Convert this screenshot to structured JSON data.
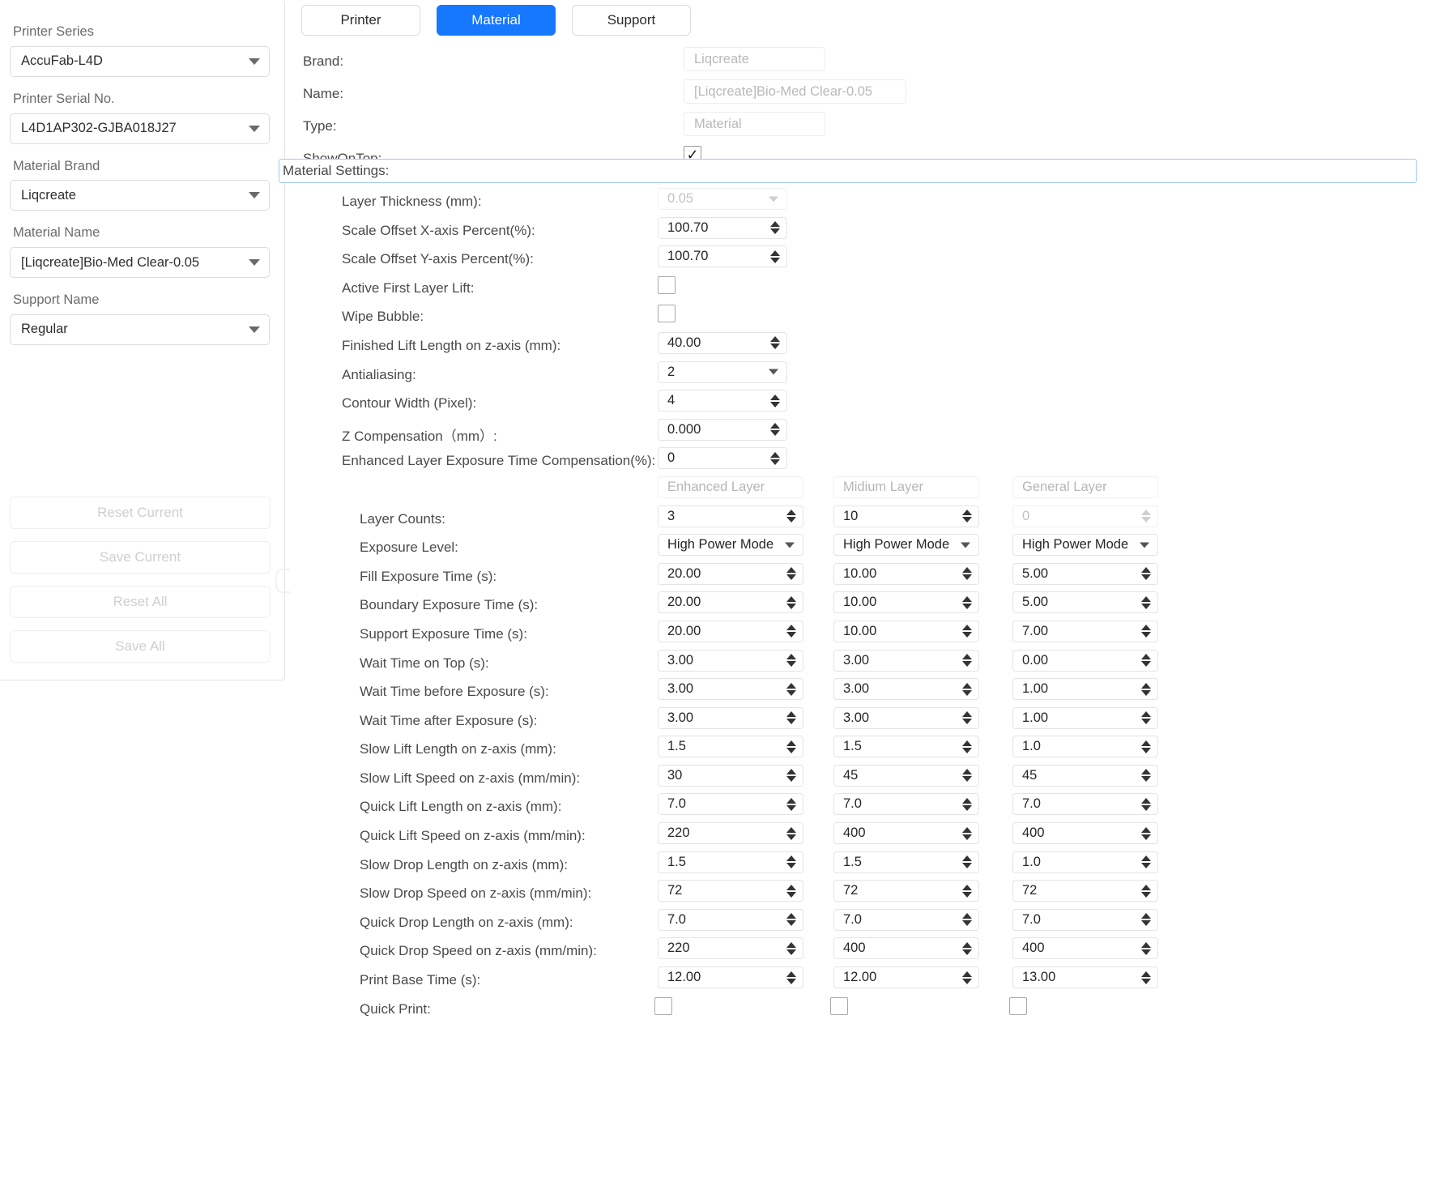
{
  "sidebar": {
    "fields": [
      {
        "label": "Printer Series",
        "value": "AccuFab-L4D"
      },
      {
        "label": "Printer Serial No.",
        "value": "L4D1AP302-GJBA018J27"
      },
      {
        "label": "Material Brand",
        "value": "Liqcreate"
      },
      {
        "label": "Material Name",
        "value": "[Liqcreate]Bio-Med Clear-0.05"
      },
      {
        "label": "Support Name",
        "value": "Regular"
      }
    ],
    "buttons": [
      {
        "label": "Reset Current"
      },
      {
        "label": "Save Current"
      },
      {
        "label": "Reset All"
      },
      {
        "label": "Save All"
      }
    ]
  },
  "tabs": [
    {
      "label": "Printer",
      "active": false
    },
    {
      "label": "Material",
      "active": true
    },
    {
      "label": "Support",
      "active": false
    }
  ],
  "header": {
    "brand_label": "Brand:",
    "brand_value": "Liqcreate",
    "name_label": "Name:",
    "name_value": "[Liqcreate]Bio-Med Clear-0.05",
    "type_label": "Type:",
    "type_value": "Material",
    "showontop_label": "ShowOnTop:",
    "showontop_checked": "✓"
  },
  "section": {
    "title": "Material Settings:"
  },
  "single_settings": [
    {
      "label": "Layer Thickness (mm):",
      "value": "0.05",
      "kind": "dropdown",
      "disabled": true
    },
    {
      "label": "Scale Offset X-axis Percent(%):",
      "value": "100.70",
      "kind": "spin",
      "disabled": false
    },
    {
      "label": "Scale Offset Y-axis Percent(%):",
      "value": "100.70",
      "kind": "spin",
      "disabled": false
    },
    {
      "label": "Active First Layer Lift:",
      "value": "",
      "kind": "checkbox",
      "disabled": false
    },
    {
      "label": "Wipe Bubble:",
      "value": "",
      "kind": "checkbox",
      "disabled": false
    },
    {
      "label": "Finished Lift Length on z-axis (mm):",
      "value": "40.00",
      "kind": "spin",
      "disabled": false
    },
    {
      "label": "Antialiasing:",
      "value": "2",
      "kind": "dropdown",
      "disabled": false
    },
    {
      "label": "Contour Width (Pixel):",
      "value": "4",
      "kind": "spin",
      "disabled": false
    },
    {
      "label": "Z Compensation（mm）:",
      "value": "0.000",
      "kind": "spin",
      "disabled": false
    },
    {
      "label": "Enhanced Layer Exposure Time Compensation(%):",
      "value": "0",
      "kind": "spin",
      "disabled": false
    }
  ],
  "columns": {
    "headers": [
      "Enhanced Layer",
      "Midium Layer",
      "General Layer"
    ],
    "rows": [
      {
        "label": "Layer Counts:",
        "kind": "spin",
        "values": [
          "3",
          "10",
          "0"
        ],
        "disabled": [
          false,
          false,
          true
        ]
      },
      {
        "label": "Exposure Level:",
        "kind": "dropdown",
        "values": [
          "High Power Mode",
          "High Power Mode",
          "High Power Mode"
        ],
        "disabled": [
          false,
          false,
          false
        ]
      },
      {
        "label": "Fill Exposure Time (s):",
        "kind": "spin",
        "values": [
          "20.00",
          "10.00",
          "5.00"
        ],
        "disabled": [
          false,
          false,
          false
        ]
      },
      {
        "label": "Boundary Exposure Time (s):",
        "kind": "spin",
        "values": [
          "20.00",
          "10.00",
          "5.00"
        ],
        "disabled": [
          false,
          false,
          false
        ]
      },
      {
        "label": "Support Exposure Time (s):",
        "kind": "spin",
        "values": [
          "20.00",
          "10.00",
          "7.00"
        ],
        "disabled": [
          false,
          false,
          false
        ]
      },
      {
        "label": "Wait Time on Top (s):",
        "kind": "spin",
        "values": [
          "3.00",
          "3.00",
          "0.00"
        ],
        "disabled": [
          false,
          false,
          false
        ]
      },
      {
        "label": "Wait Time before Exposure (s):",
        "kind": "spin",
        "values": [
          "3.00",
          "3.00",
          "1.00"
        ],
        "disabled": [
          false,
          false,
          false
        ]
      },
      {
        "label": "Wait Time after Exposure (s):",
        "kind": "spin",
        "values": [
          "3.00",
          "3.00",
          "1.00"
        ],
        "disabled": [
          false,
          false,
          false
        ]
      },
      {
        "label": "Slow Lift Length on z-axis (mm):",
        "kind": "spin",
        "values": [
          "1.5",
          "1.5",
          "1.0"
        ],
        "disabled": [
          false,
          false,
          false
        ]
      },
      {
        "label": "Slow Lift Speed on z-axis (mm/min):",
        "kind": "spin",
        "values": [
          "30",
          "45",
          "45"
        ],
        "disabled": [
          false,
          false,
          false
        ]
      },
      {
        "label": "Quick Lift Length on z-axis (mm):",
        "kind": "spin",
        "values": [
          "7.0",
          "7.0",
          "7.0"
        ],
        "disabled": [
          false,
          false,
          false
        ]
      },
      {
        "label": "Quick Lift Speed on z-axis (mm/min):",
        "kind": "spin",
        "values": [
          "220",
          "400",
          "400"
        ],
        "disabled": [
          false,
          false,
          false
        ]
      },
      {
        "label": "Slow Drop Length on z-axis (mm):",
        "kind": "spin",
        "values": [
          "1.5",
          "1.5",
          "1.0"
        ],
        "disabled": [
          false,
          false,
          false
        ]
      },
      {
        "label": "Slow Drop Speed on z-axis (mm/min):",
        "kind": "spin",
        "values": [
          "72",
          "72",
          "72"
        ],
        "disabled": [
          false,
          false,
          false
        ]
      },
      {
        "label": "Quick Drop Length on z-axis (mm):",
        "kind": "spin",
        "values": [
          "7.0",
          "7.0",
          "7.0"
        ],
        "disabled": [
          false,
          false,
          false
        ]
      },
      {
        "label": "Quick Drop Speed on z-axis (mm/min):",
        "kind": "spin",
        "values": [
          "220",
          "400",
          "400"
        ],
        "disabled": [
          false,
          false,
          false
        ]
      },
      {
        "label": "Print Base Time (s):",
        "kind": "spin",
        "values": [
          "12.00",
          "12.00",
          "13.00"
        ],
        "disabled": [
          false,
          false,
          false
        ]
      },
      {
        "label": "Quick Print:",
        "kind": "checkbox",
        "values": [
          "",
          "",
          ""
        ],
        "disabled": [
          false,
          false,
          false
        ]
      }
    ]
  },
  "colors": {
    "accent": "#1677ff",
    "border": "#dcdcdc",
    "section_border": "#9fcdf0",
    "text": "#4a4a4a"
  }
}
